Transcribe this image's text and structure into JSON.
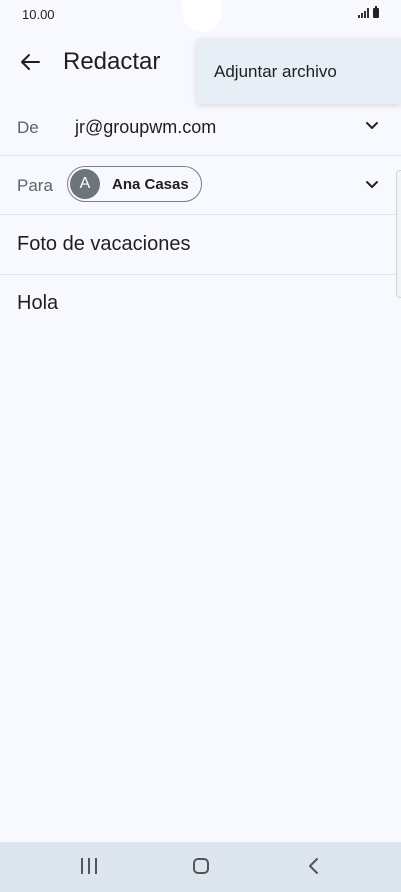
{
  "status_bar": {
    "time": "10.00",
    "signal_icon": "signal-icon",
    "battery_icon": "battery-icon"
  },
  "app_bar": {
    "back_icon": "arrow-back-icon",
    "title": "Redactar"
  },
  "overflow_menu": {
    "items": [
      {
        "label": "Adjuntar archivo"
      }
    ]
  },
  "compose": {
    "from": {
      "label": "De",
      "value": "jr@groupwm.com"
    },
    "to": {
      "label": "Para",
      "recipient": {
        "initial": "A",
        "name": "Ana Casas"
      }
    },
    "subject": "Foto de vacaciones",
    "body": "Hola"
  },
  "nav_bar": {
    "recent_icon": "recent-apps-icon",
    "home_icon": "home-icon",
    "back_icon": "back-icon"
  },
  "colors": {
    "background": "#f8f9fe",
    "menu_background": "#e7eef6",
    "avatar": "#6e747b",
    "nav_bar": "#dde5ee"
  }
}
